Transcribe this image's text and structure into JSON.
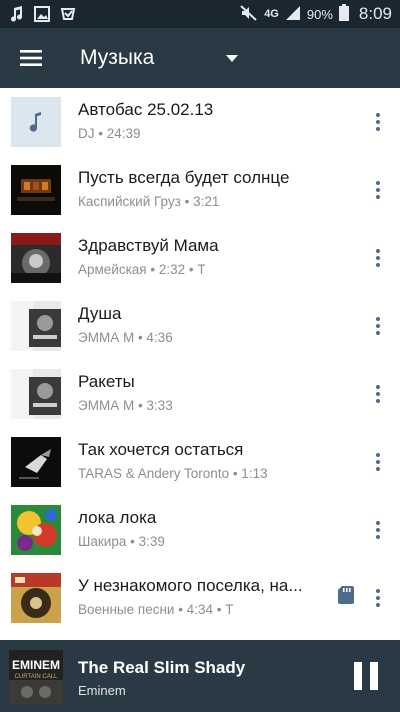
{
  "status_bar": {
    "network": "4G",
    "battery": "90%",
    "time": "8:09"
  },
  "app_bar": {
    "title": "Музыка"
  },
  "tracks": [
    {
      "title": "Автобас 25.02.13",
      "subtitle": "DJ • 24:39"
    },
    {
      "title": "Пусть всегда будет солнце",
      "subtitle": "Каспийский Груз • 3:21"
    },
    {
      "title": "Здравствуй Мама",
      "subtitle": "Армейская • 2:32 • T"
    },
    {
      "title": "Душа",
      "subtitle": "ЭММА М  • 4:36"
    },
    {
      "title": "Ракеты",
      "subtitle": "ЭММА М  • 3:33"
    },
    {
      "title": "Так хочется остаться",
      "subtitle": "TARAS & Andery Toronto • 1:13"
    },
    {
      "title": "лока лока",
      "subtitle": "Шакира • 3:39"
    },
    {
      "title": "У незнакомого поселка, на...",
      "subtitle": "Военные песни • 4:34 • T"
    }
  ],
  "now_playing": {
    "title": "The Real Slim Shady",
    "artist": "Eminem",
    "art_text": "EMINEM",
    "art_subtext": "CURTAIN CALL"
  },
  "colors": {
    "status_bar": "#1b2730",
    "app_bar": "#2a3a45",
    "accent": "#4d6b8c"
  },
  "icons": {
    "status": [
      "music-note-icon",
      "image-icon",
      "check-icon",
      "mute-icon",
      "signal-icon",
      "battery-icon"
    ],
    "menu": "hamburger-menu-icon",
    "dropdown": "dropdown-arrow-icon",
    "track_more": "more-vertical-icon",
    "saved": "sd-card-icon",
    "player": "pause-icon"
  }
}
